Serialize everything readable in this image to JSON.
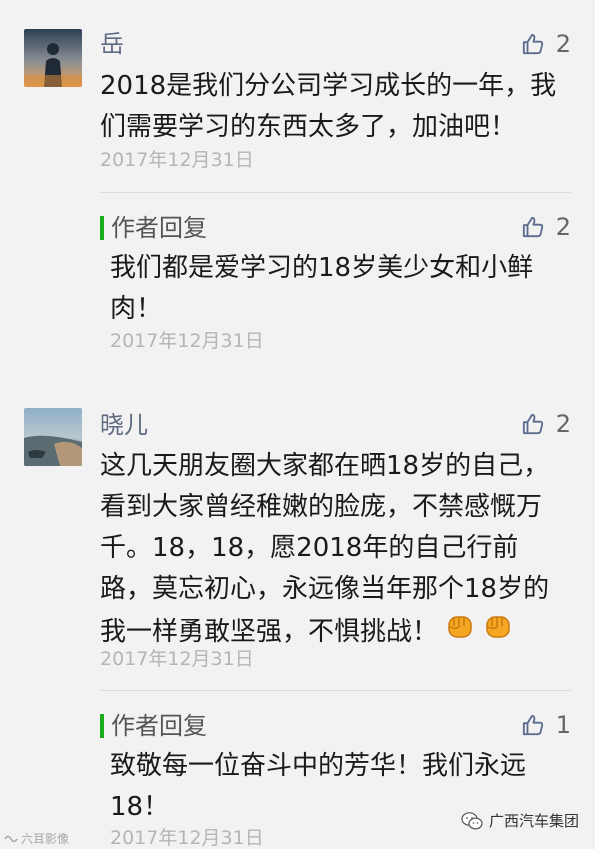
{
  "comments": [
    {
      "nickname": "岳",
      "likes": "2",
      "content": "2018是我们分公司学习成长的一年，我们需要学习的东西太多了，加油吧！",
      "date": "2017年12月31日",
      "reply": {
        "label": "作者回复",
        "likes": "2",
        "content": "我们都是爱学习的18岁美少女和小鲜肉！",
        "date": "2017年12月31日"
      }
    },
    {
      "nickname": "晓儿",
      "likes": "2",
      "content": "这几天朋友圈大家都在晒18岁的自己，看到大家曾经稚嫩的脸庞，不禁感慨万千。18，18，愿2018年的自己行前路，莫忘初心，永远像当年那个18岁的我一样勇敢坚强，不惧挑战！",
      "emoji": "fist-emoji",
      "date": "2017年12月31日",
      "reply": {
        "label": "作者回复",
        "likes": "1",
        "content": "致敬每一位奋斗中的芳华！我们永远18！",
        "date": "2017年12月31日"
      }
    }
  ],
  "watermark": {
    "left_text": "六耳影像",
    "right_text": "广西汽车集团"
  },
  "colors": {
    "background": "#f2f2f2",
    "nickname": "#5e6b82",
    "reply_bar": "#1aad19",
    "date": "#b5b5b5",
    "like_icon": "#5b6c8e"
  }
}
